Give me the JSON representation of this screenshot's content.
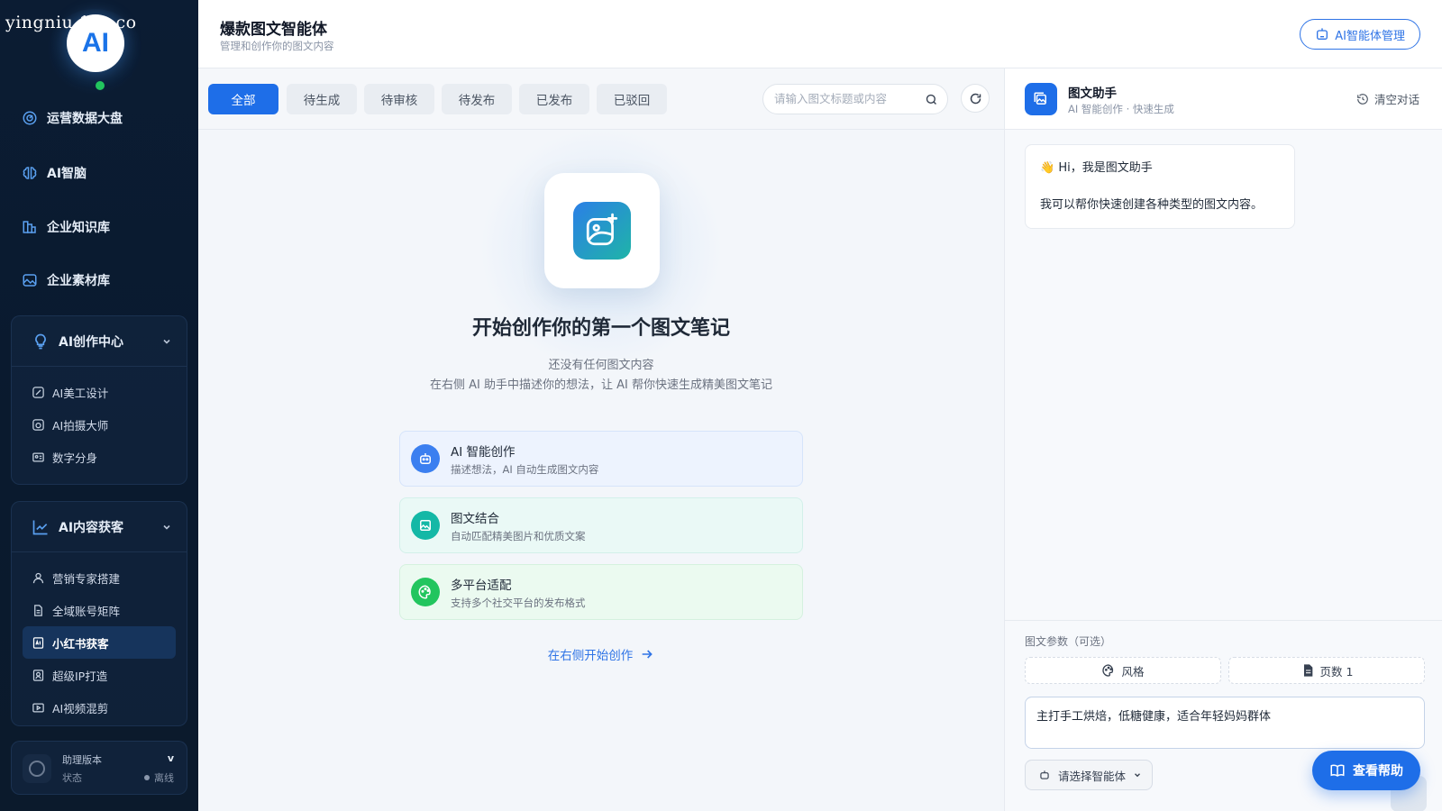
{
  "watermark": "yingniu.10v.co",
  "logo": {
    "text": "AI"
  },
  "sidebar": {
    "top_items": [
      {
        "label": "运营数据大盘",
        "icon": "dashboard-icon"
      },
      {
        "label": "AI智脑",
        "icon": "brain-icon"
      },
      {
        "label": "企业知识库",
        "icon": "library-icon"
      },
      {
        "label": "企业素材库",
        "icon": "image-library-icon"
      }
    ],
    "groups": [
      {
        "label": "AI创作中心",
        "icon": "bulb-icon",
        "items": [
          {
            "label": "AI美工设计"
          },
          {
            "label": "AI拍摄大师"
          },
          {
            "label": "数字分身"
          }
        ]
      },
      {
        "label": "AI内容获客",
        "icon": "trend-icon",
        "items": [
          {
            "label": "营销专家搭建"
          },
          {
            "label": "全域账号矩阵"
          },
          {
            "label": "小红书获客",
            "active": true
          },
          {
            "label": "超级IP打造"
          },
          {
            "label": "AI视频混剪"
          }
        ]
      }
    ],
    "version": {
      "title": "助理版本",
      "status_label": "状态",
      "badge": "v",
      "status": "离线"
    }
  },
  "header": {
    "title": "爆款图文智能体",
    "subtitle": "管理和创作你的图文内容",
    "manage_button": "AI智能体管理"
  },
  "tabs": [
    {
      "label": "全部",
      "active": true
    },
    {
      "label": "待生成"
    },
    {
      "label": "待审核"
    },
    {
      "label": "待发布"
    },
    {
      "label": "已发布"
    },
    {
      "label": "已驳回"
    }
  ],
  "search": {
    "placeholder": "请输入图文标题或内容",
    "value": ""
  },
  "empty_state": {
    "title": "开始创作你的第一个图文笔记",
    "desc1": "还没有任何图文内容",
    "desc2": "在右侧 AI 助手中描述你的想法，让 AI 帮你快速生成精美图文笔记",
    "features": [
      {
        "title": "AI 智能创作",
        "desc": "描述想法，AI 自动生成图文内容",
        "icon": "robot-icon",
        "color": "#3b7ff0"
      },
      {
        "title": "图文结合",
        "desc": "自动匹配精美图片和优质文案",
        "icon": "picture-icon",
        "color": "#14b8a6"
      },
      {
        "title": "多平台适配",
        "desc": "支持多个社交平台的发布格式",
        "icon": "palette-icon",
        "color": "#22c55e"
      }
    ],
    "start_link": "在右侧开始创作"
  },
  "assistant": {
    "name": "图文助手",
    "subtitle": "AI 智能创作 · 快速生成",
    "clear_button": "清空对话",
    "greeting": "👋 Hi，我是图文助手",
    "message": "我可以帮你快速创建各种类型的图文内容。"
  },
  "params": {
    "label": "图文参数（可选）",
    "style_button": "风格",
    "pages_button": "页数 1",
    "prompt_value": "主打手工烘焙，低糖健康，适合年轻妈妈群体",
    "agent_select": "请选择智能体"
  },
  "help_button": "查看帮助",
  "colors": {
    "primary": "#1e6ee8",
    "sidebar_bg": "#0b1c33",
    "online": "#22c55e"
  }
}
